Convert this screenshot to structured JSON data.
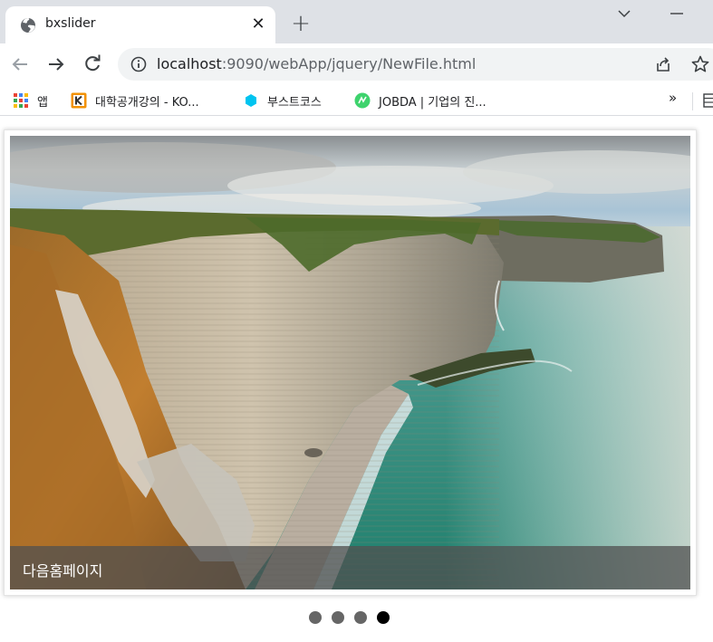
{
  "browser": {
    "tab": {
      "title": "bxslider",
      "favicon": "globe-icon",
      "close_label": "✕"
    },
    "new_tab_label": "+",
    "toolbar": {
      "back": "arrow-left-icon",
      "forward": "arrow-right-icon",
      "reload": "reload-icon",
      "url_host": "localhost",
      "url_rest": ":9090/webApp/jquery/NewFile.html"
    },
    "bookmarks": [
      {
        "label": "앱",
        "icon": "apps-grid-icon"
      },
      {
        "label": "대학공개강의 - KO...",
        "icon": "kocw-icon"
      },
      {
        "label": "부스트코스",
        "icon": "boostcourse-icon"
      },
      {
        "label": "JOBDA | 기업의 진...",
        "icon": "jobda-icon"
      }
    ],
    "bookmarks_more": "»"
  },
  "page": {
    "slider": {
      "caption": "다음홈페이지",
      "slide_image": "coastal-cliffs-photo",
      "pager": {
        "count": 4,
        "active_index": 3
      }
    }
  },
  "colors": {
    "tabstrip_bg": "#dee1e6",
    "omnibox_bg": "#f1f3f4",
    "caption_bg": "#505050",
    "pager_dot": "#666666",
    "pager_dot_active": "#000000"
  }
}
